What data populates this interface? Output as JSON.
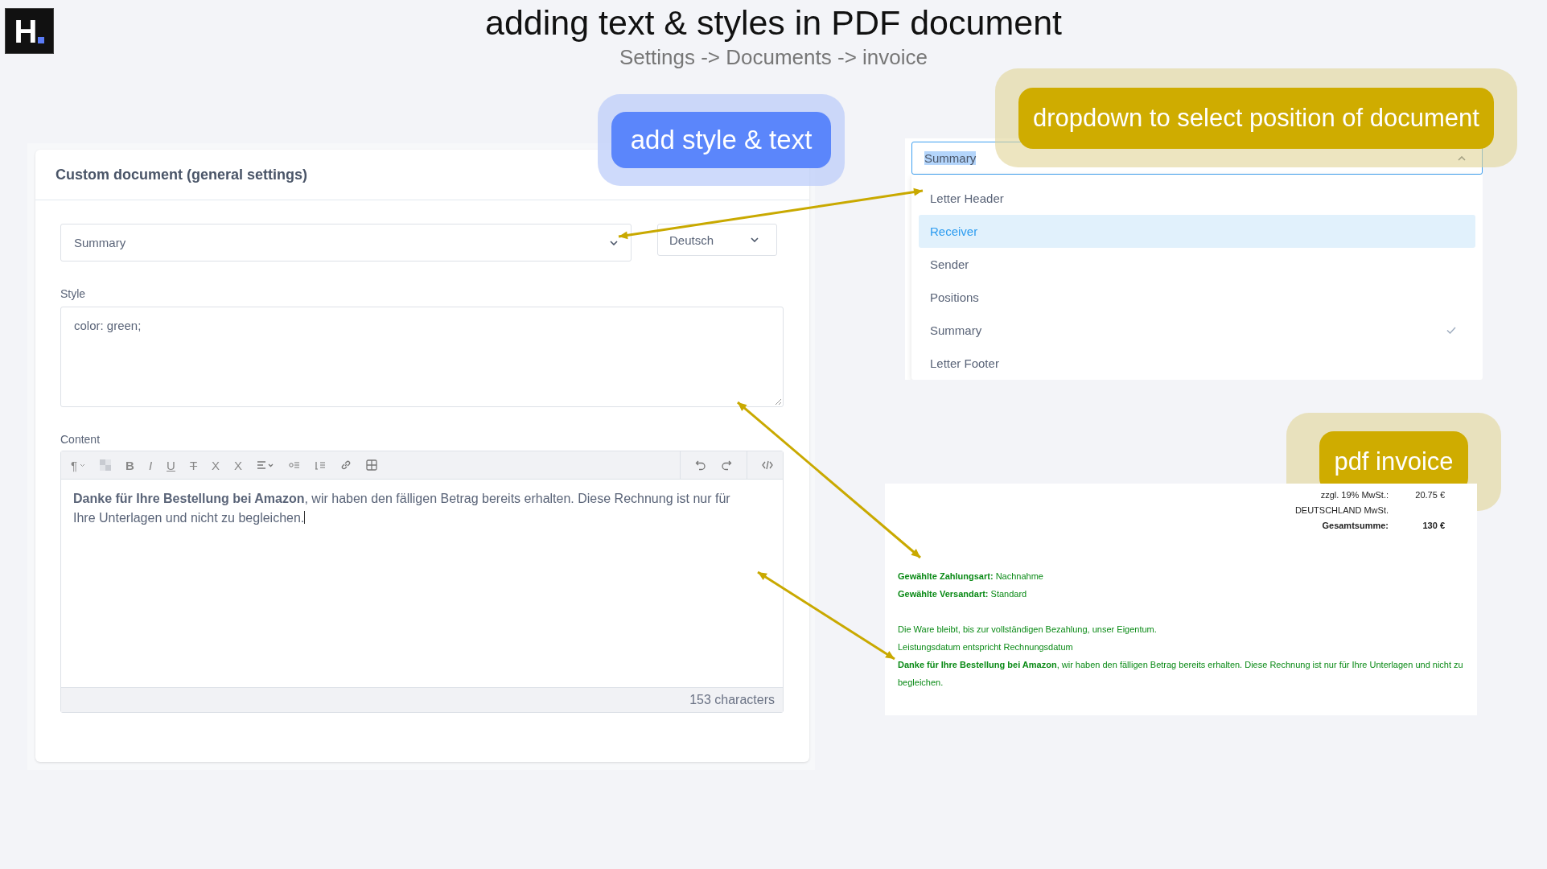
{
  "header": {
    "logo": "H",
    "title": "adding text & styles in PDF document",
    "subtitle": "Settings -> Documents -> invoice"
  },
  "editor_panel": {
    "title": "Custom document (general settings)",
    "position_select": {
      "value": "Summary"
    },
    "language_select": {
      "value": "Deutsch"
    },
    "style_field": {
      "label": "Style",
      "value": "color: green;"
    },
    "content_editor": {
      "label": "Content",
      "toolbar": [
        {
          "kind": "paragraph",
          "label": "¶"
        },
        {
          "kind": "clear"
        },
        {
          "kind": "bold",
          "label": "B"
        },
        {
          "kind": "italic",
          "label": "I"
        },
        {
          "kind": "underline",
          "label": "U"
        },
        {
          "kind": "strike",
          "label": "T"
        },
        {
          "kind": "superscript",
          "label": "X"
        },
        {
          "kind": "subscript",
          "label": "X"
        },
        {
          "kind": "align"
        },
        {
          "kind": "bullets"
        },
        {
          "kind": "numbers"
        },
        {
          "kind": "link"
        },
        {
          "kind": "table"
        },
        {
          "kind": "undo"
        },
        {
          "kind": "redo"
        },
        {
          "kind": "code"
        }
      ],
      "text": "**Danke für Ihre Bestellung bei Amazon**, wir haben den fälligen Betrag bereits erhalten. Diese Rechnung ist nur für Ihre Unterlagen und nicht zu begleichen.",
      "char_count": "153 characters"
    }
  },
  "position_dropdown": {
    "value": "Summary",
    "expanded": true,
    "options": [
      {
        "label": "Letter Header",
        "highlighted": false,
        "selected": false
      },
      {
        "label": "Receiver",
        "highlighted": true,
        "selected": false
      },
      {
        "label": "Sender",
        "highlighted": false,
        "selected": false
      },
      {
        "label": "Positions",
        "highlighted": false,
        "selected": false
      },
      {
        "label": "Summary",
        "highlighted": false,
        "selected": true
      },
      {
        "label": "Letter Footer",
        "highlighted": false,
        "selected": false
      }
    ]
  },
  "pdf_invoice": {
    "totals": [
      {
        "kind": "normal",
        "label": "zzgl. 19% MwSt.:",
        "amount": "20.75 €"
      },
      {
        "kind": "normal",
        "label": "DEUTSCHLAND MwSt."
      },
      {
        "kind": "total",
        "label": "Gesamtsumme:",
        "amount": "130 €"
      }
    ],
    "lines": [
      "**Gewählte Zahlungsart:** Nachnahme",
      "**Gewählte Versandart:** Standard",
      "Die Ware bleibt, bis zur vollständigen Bezahlung, unser Eigentum.",
      "Leistungsdatum entspricht Rechnungsdatum",
      "**Danke für Ihre Bestellung bei Amazon**, wir haben den fälligen Betrag bereits erhalten. Diese Rechnung ist nur für Ihre Unterlagen und nicht zu begleichen."
    ]
  },
  "annotations": [
    {
      "kind": "blue",
      "text": "add style & text"
    },
    {
      "kind": "yellow",
      "text": "dropdown to select position of document"
    },
    {
      "kind": "yellow",
      "text": "pdf invoice"
    }
  ]
}
